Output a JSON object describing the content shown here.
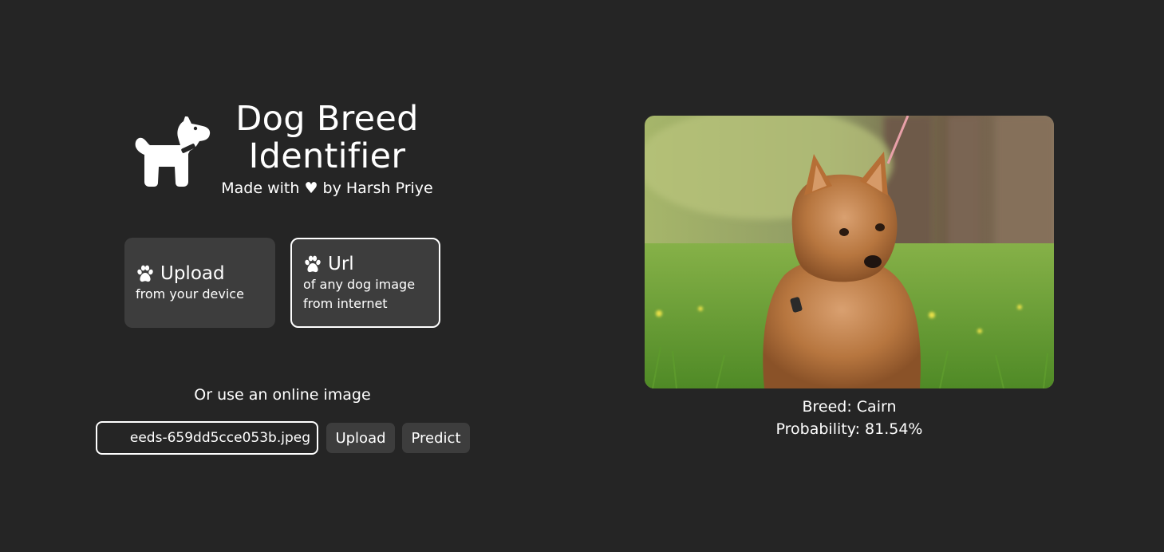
{
  "header": {
    "title_line1": "Dog Breed",
    "title_line2": "Identifier",
    "tagline": "Made with ♥ by Harsh Priye",
    "logo_icon": "dog-icon"
  },
  "options": {
    "upload": {
      "title": "Upload",
      "subtitle": "from your device",
      "icon": "paw-icon"
    },
    "url": {
      "title": "Url",
      "subtitle_line1": "of any dog image",
      "subtitle_line2": "from internet",
      "icon": "paw-icon",
      "selected": true
    }
  },
  "url_form": {
    "label": "Or use an online image",
    "input_value": "eeds-659dd5cce053b.jpeg",
    "upload_button": "Upload",
    "predict_button": "Predict"
  },
  "result": {
    "breed_text": "Breed: Cairn",
    "probability_text": "Probability: 81.54%"
  },
  "colors": {
    "background": "#252525",
    "card": "#3d3d3d",
    "text": "#ffffff"
  }
}
